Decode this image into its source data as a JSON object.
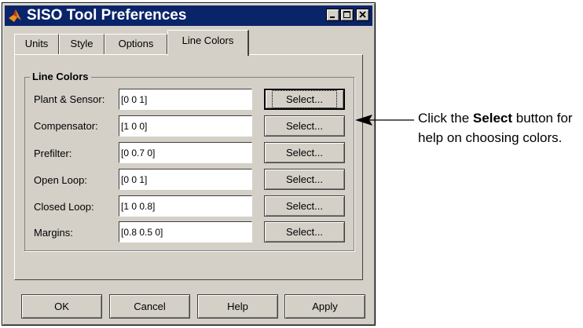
{
  "window": {
    "title": "SISO Tool Preferences"
  },
  "tabs": [
    {
      "label": "Units"
    },
    {
      "label": "Style"
    },
    {
      "label": "Options"
    },
    {
      "label": "Line Colors",
      "active": true
    }
  ],
  "group": {
    "label": "Line Colors",
    "rows": [
      {
        "label": "Plant & Sensor:",
        "value": "[0 0 1]",
        "button": "Select..."
      },
      {
        "label": "Compensator:",
        "value": "[1 0 0]",
        "button": "Select..."
      },
      {
        "label": "Prefilter:",
        "value": "[0 0.7 0]",
        "button": "Select..."
      },
      {
        "label": "Open Loop:",
        "value": "[0 0 1]",
        "button": "Select..."
      },
      {
        "label": "Closed Loop:",
        "value": "[1 0 0.8]",
        "button": "Select..."
      },
      {
        "label": "Margins:",
        "value": "[0.8 0.5 0]",
        "button": "Select..."
      }
    ]
  },
  "bottom_buttons": {
    "ok": "OK",
    "cancel": "Cancel",
    "help": "Help",
    "apply": "Apply"
  },
  "callout": {
    "prefix": "Click the ",
    "bold": "Select",
    "suffix": " button for",
    "line2": "help on choosing colors."
  },
  "colors": {
    "titlebar": "#0a246a",
    "dialog_face": "#d4d0c8"
  },
  "icons": {
    "app": "matlab-logo-icon",
    "minimize": "minimize-icon",
    "maximize": "maximize-icon",
    "close": "close-icon"
  }
}
